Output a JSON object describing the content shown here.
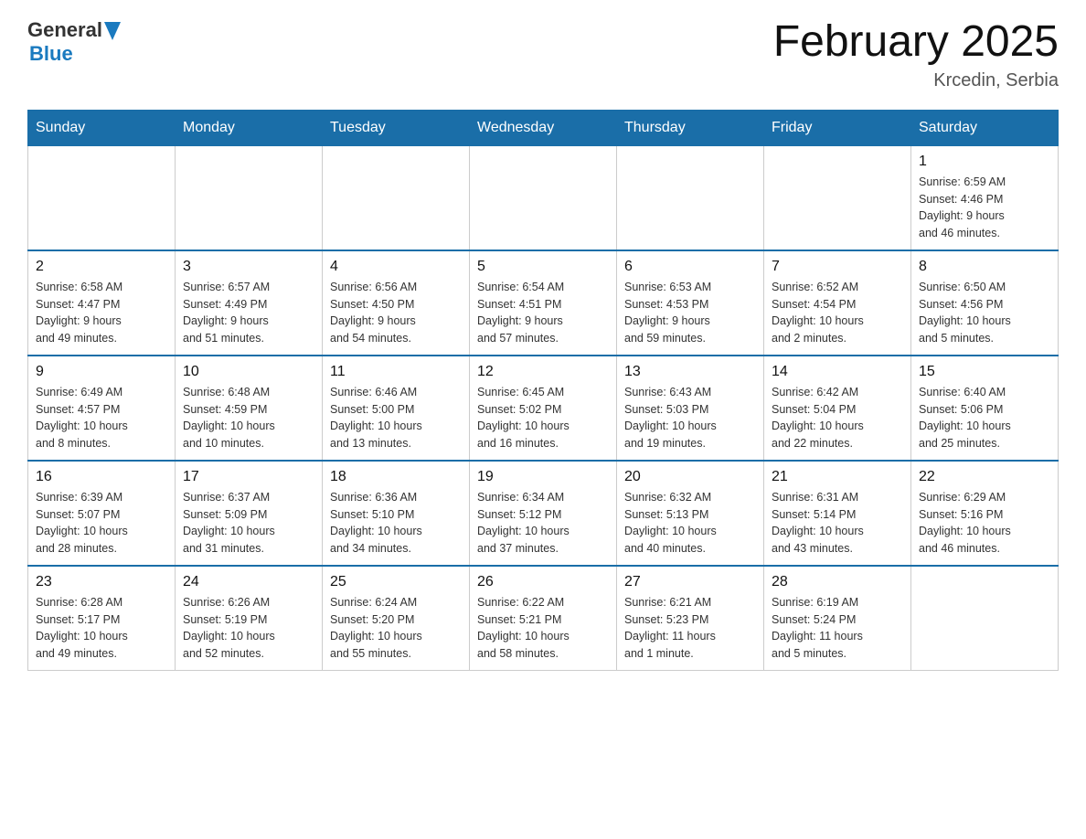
{
  "header": {
    "logo_general": "General",
    "logo_blue": "Blue",
    "month_title": "February 2025",
    "location": "Krcedin, Serbia"
  },
  "weekdays": [
    "Sunday",
    "Monday",
    "Tuesday",
    "Wednesday",
    "Thursday",
    "Friday",
    "Saturday"
  ],
  "weeks": [
    [
      {
        "day": "",
        "info": ""
      },
      {
        "day": "",
        "info": ""
      },
      {
        "day": "",
        "info": ""
      },
      {
        "day": "",
        "info": ""
      },
      {
        "day": "",
        "info": ""
      },
      {
        "day": "",
        "info": ""
      },
      {
        "day": "1",
        "info": "Sunrise: 6:59 AM\nSunset: 4:46 PM\nDaylight: 9 hours\nand 46 minutes."
      }
    ],
    [
      {
        "day": "2",
        "info": "Sunrise: 6:58 AM\nSunset: 4:47 PM\nDaylight: 9 hours\nand 49 minutes."
      },
      {
        "day": "3",
        "info": "Sunrise: 6:57 AM\nSunset: 4:49 PM\nDaylight: 9 hours\nand 51 minutes."
      },
      {
        "day": "4",
        "info": "Sunrise: 6:56 AM\nSunset: 4:50 PM\nDaylight: 9 hours\nand 54 minutes."
      },
      {
        "day": "5",
        "info": "Sunrise: 6:54 AM\nSunset: 4:51 PM\nDaylight: 9 hours\nand 57 minutes."
      },
      {
        "day": "6",
        "info": "Sunrise: 6:53 AM\nSunset: 4:53 PM\nDaylight: 9 hours\nand 59 minutes."
      },
      {
        "day": "7",
        "info": "Sunrise: 6:52 AM\nSunset: 4:54 PM\nDaylight: 10 hours\nand 2 minutes."
      },
      {
        "day": "8",
        "info": "Sunrise: 6:50 AM\nSunset: 4:56 PM\nDaylight: 10 hours\nand 5 minutes."
      }
    ],
    [
      {
        "day": "9",
        "info": "Sunrise: 6:49 AM\nSunset: 4:57 PM\nDaylight: 10 hours\nand 8 minutes."
      },
      {
        "day": "10",
        "info": "Sunrise: 6:48 AM\nSunset: 4:59 PM\nDaylight: 10 hours\nand 10 minutes."
      },
      {
        "day": "11",
        "info": "Sunrise: 6:46 AM\nSunset: 5:00 PM\nDaylight: 10 hours\nand 13 minutes."
      },
      {
        "day": "12",
        "info": "Sunrise: 6:45 AM\nSunset: 5:02 PM\nDaylight: 10 hours\nand 16 minutes."
      },
      {
        "day": "13",
        "info": "Sunrise: 6:43 AM\nSunset: 5:03 PM\nDaylight: 10 hours\nand 19 minutes."
      },
      {
        "day": "14",
        "info": "Sunrise: 6:42 AM\nSunset: 5:04 PM\nDaylight: 10 hours\nand 22 minutes."
      },
      {
        "day": "15",
        "info": "Sunrise: 6:40 AM\nSunset: 5:06 PM\nDaylight: 10 hours\nand 25 minutes."
      }
    ],
    [
      {
        "day": "16",
        "info": "Sunrise: 6:39 AM\nSunset: 5:07 PM\nDaylight: 10 hours\nand 28 minutes."
      },
      {
        "day": "17",
        "info": "Sunrise: 6:37 AM\nSunset: 5:09 PM\nDaylight: 10 hours\nand 31 minutes."
      },
      {
        "day": "18",
        "info": "Sunrise: 6:36 AM\nSunset: 5:10 PM\nDaylight: 10 hours\nand 34 minutes."
      },
      {
        "day": "19",
        "info": "Sunrise: 6:34 AM\nSunset: 5:12 PM\nDaylight: 10 hours\nand 37 minutes."
      },
      {
        "day": "20",
        "info": "Sunrise: 6:32 AM\nSunset: 5:13 PM\nDaylight: 10 hours\nand 40 minutes."
      },
      {
        "day": "21",
        "info": "Sunrise: 6:31 AM\nSunset: 5:14 PM\nDaylight: 10 hours\nand 43 minutes."
      },
      {
        "day": "22",
        "info": "Sunrise: 6:29 AM\nSunset: 5:16 PM\nDaylight: 10 hours\nand 46 minutes."
      }
    ],
    [
      {
        "day": "23",
        "info": "Sunrise: 6:28 AM\nSunset: 5:17 PM\nDaylight: 10 hours\nand 49 minutes."
      },
      {
        "day": "24",
        "info": "Sunrise: 6:26 AM\nSunset: 5:19 PM\nDaylight: 10 hours\nand 52 minutes."
      },
      {
        "day": "25",
        "info": "Sunrise: 6:24 AM\nSunset: 5:20 PM\nDaylight: 10 hours\nand 55 minutes."
      },
      {
        "day": "26",
        "info": "Sunrise: 6:22 AM\nSunset: 5:21 PM\nDaylight: 10 hours\nand 58 minutes."
      },
      {
        "day": "27",
        "info": "Sunrise: 6:21 AM\nSunset: 5:23 PM\nDaylight: 11 hours\nand 1 minute."
      },
      {
        "day": "28",
        "info": "Sunrise: 6:19 AM\nSunset: 5:24 PM\nDaylight: 11 hours\nand 5 minutes."
      },
      {
        "day": "",
        "info": ""
      }
    ]
  ]
}
